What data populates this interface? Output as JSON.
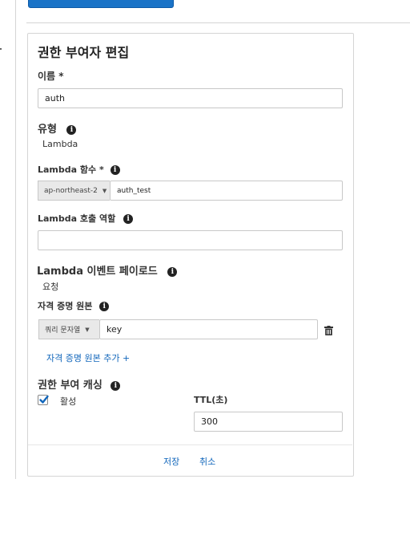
{
  "header": {
    "title": "권한 부여자 편집"
  },
  "name": {
    "label": "이름 *",
    "value": "auth"
  },
  "type": {
    "label": "유형",
    "value": "Lambda"
  },
  "lambda_function": {
    "label": "Lambda 함수 *",
    "region": "ap-northeast-2",
    "value": "auth_test"
  },
  "lambda_role": {
    "label": "Lambda 호출 역할",
    "value": ""
  },
  "event_payload": {
    "label": "Lambda 이벤트 페이로드",
    "value": "요청"
  },
  "identity_source": {
    "label": "자격 증명 원본",
    "source_type": "쿼리 문자열",
    "value": "key",
    "add_link": "자격 증명 원본 추가 +"
  },
  "caching": {
    "label": "권한 부여 캐싱",
    "enabled_label": "활성",
    "ttl_label": "TTL(초)",
    "ttl_value": "300",
    "enabled": true
  },
  "footer": {
    "save_label": "저장",
    "cancel_label": "취소"
  },
  "icons": {
    "info": "info-icon",
    "trash": "trash-icon",
    "check": "check-icon",
    "caret": "caret-down-icon"
  },
  "colors": {
    "link": "#1166bb",
    "primary_button": "#1a73c7"
  }
}
